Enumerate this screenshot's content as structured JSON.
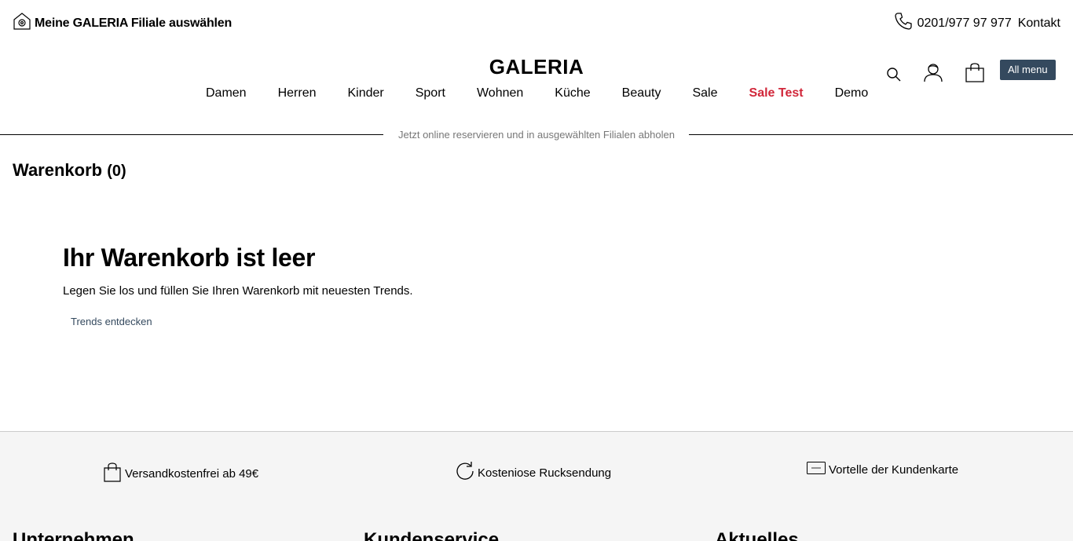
{
  "topbar": {
    "store_label": "Meine GALERIA Filiale auswählen",
    "phone": "0201/977 97 977",
    "contact_label": "Kontakt"
  },
  "header": {
    "logo": "GALERIA",
    "all_menu_label": "All menu",
    "icons": [
      "search-icon",
      "account-icon",
      "cart-icon"
    ]
  },
  "nav": {
    "items": [
      {
        "label": "Damen"
      },
      {
        "label": "Herren"
      },
      {
        "label": "Kinder"
      },
      {
        "label": "Sport"
      },
      {
        "label": "Wohnen"
      },
      {
        "label": "Küche"
      },
      {
        "label": "Beauty"
      },
      {
        "label": "Sale"
      },
      {
        "label": "Sale Test"
      },
      {
        "label": "Demo"
      }
    ]
  },
  "banner": {
    "text": "Jetzt online reservieren und in ausgewählten Filialen abholen"
  },
  "cart": {
    "title": "Warenkorb",
    "count": "(0)",
    "empty_title": "Ihr Warenkorb ist leer",
    "empty_text": "Legen Sie los und füllen Sie Ihren Warenkorb mit neuesten Trends.",
    "cta_label": "Trends entdecken"
  },
  "footer": {
    "benefits": [
      {
        "label": "Versandkostenfrei ab 49€",
        "icon": "shopping-bag-icon"
      },
      {
        "label": "Kosteniose Rucksendung",
        "icon": "refresh-icon"
      },
      {
        "label": "Vortelle der Kundenkarte",
        "icon": "customer-card-icon"
      }
    ],
    "headings": [
      "Unternehmen",
      "Kundenservice",
      "Aktuelles"
    ]
  },
  "colors": {
    "sale_red": "#d1273a",
    "button_dark": "#34495e",
    "divider_text": "#777777",
    "footer_bg": "#f5f5f5"
  }
}
